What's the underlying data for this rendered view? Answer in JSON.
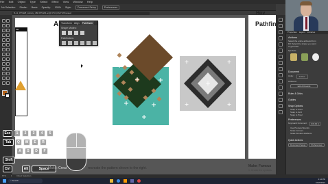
{
  "app": {
    "menu": [
      "File",
      "Edit",
      "Object",
      "Type",
      "Select",
      "Effect",
      "View",
      "Window",
      "Help"
    ],
    "control_bar": [
      "No Selection",
      "Stroke:",
      "Basic",
      "Opacity:",
      "100%",
      "Style:",
      "Document Setup",
      "Preferences"
    ],
    "doc_tab": "B-12_PP4W8_Activity_4B0 PP4W4.ai @ 67% (CMYK/Preview)"
  },
  "artboard": {
    "letter_a": "A",
    "left_box_header": "Ma",
    "right_title": "Pathfin",
    "right_top": "Hov",
    "bottom_left_title": "Make: Creat",
    "bottom_instruction": "recreate the pattern shown to the right.",
    "bottom_right_title": "Make: Famous",
    "bottom_right_sub": "1. Create the symbols"
  },
  "pathfinder_panel": {
    "tabs": [
      "Transform",
      "Align",
      "Pathfinder"
    ],
    "shape_modes_label": "Shape Modes:",
    "pathfinders_label": "Pathfinders:"
  },
  "right_panel": {
    "tabs": [
      "Properties",
      "Layers",
      "Libraries"
    ],
    "title": "Actions",
    "hint_1": "Select the entire artboard from",
    "hint_2": "Fill: Select the shape you want",
    "hint_3": "to generate.",
    "symbols_label": "Symbols",
    "section_document": "Document",
    "units_label": "Units:",
    "units_value": "Inches",
    "artboard_label": "Artboard:",
    "edit_artboards": "Edit Artboards",
    "rulers_grid": "Ruler & Grids",
    "guides": "Guides",
    "snap_options": "Snap Options",
    "snap_to_point": "Snap to Point",
    "snap_to_grid": "Snap to Grid",
    "snap_to_pixel": "Snap to Pixel",
    "preferences": "Preferences",
    "keyboard_increment_label": "Keyboard Increment:",
    "keyboard_increment_value": "0.0139 in",
    "use_preview_bounds": "Use Preview Bounds",
    "scale_corners": "Scale Corners",
    "scale_strokes": "Scale Strokes & Effects",
    "quick_actions": "Quick Actions",
    "document_setup_button": "Document Setup",
    "preferences_button": "Preferences"
  },
  "status_bar": {
    "zoom": "67%",
    "artboard_num": "1",
    "tool": "Direct Selection"
  },
  "taskbar": {
    "time": "4:12 PM",
    "date": "10/26/2021",
    "search": "Search"
  },
  "keyboard_overlay": {
    "keys": [
      "Esc",
      "1",
      "2",
      "3",
      "4",
      "5",
      "Tab",
      "Q",
      "W",
      "E",
      "R",
      "Shift",
      "A",
      "S",
      "D",
      "F",
      "Ctrl",
      "Alt",
      "Space"
    ]
  },
  "colors": {
    "brown": "#6b4a2a",
    "tan": "#b0855a",
    "dark_green": "#1d3a1d",
    "teal": "#4bb3a5",
    "gray_tile": "#c8c8c8"
  }
}
